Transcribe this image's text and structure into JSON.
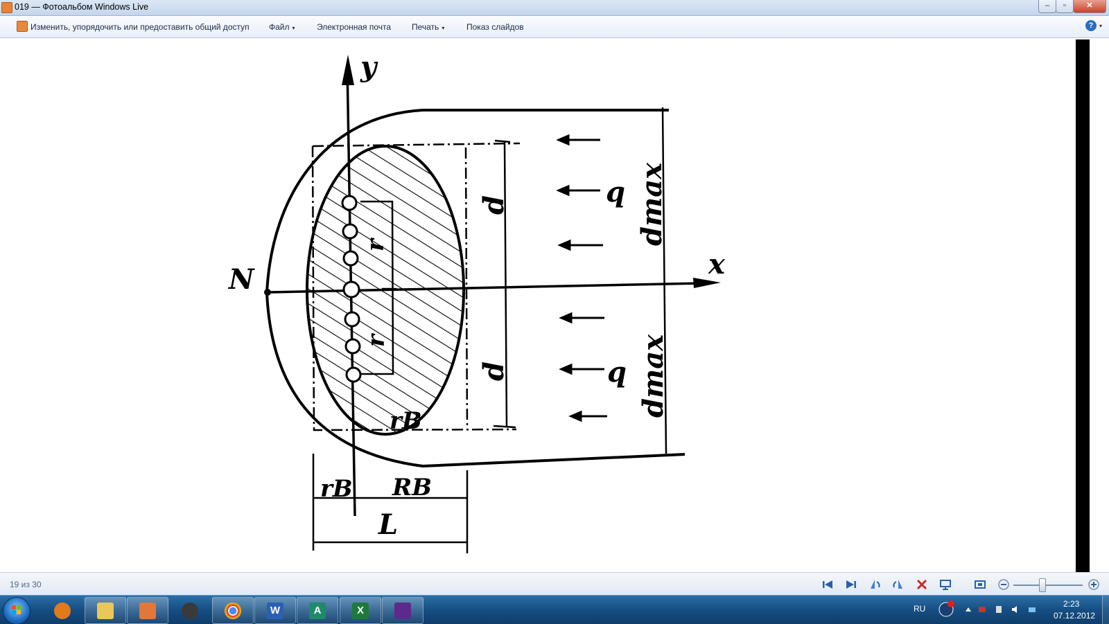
{
  "window": {
    "title": "019 — Фотоальбом Windows Live",
    "minimize_symbol": "–",
    "maximize_symbol": "▫",
    "close_symbol": "✕"
  },
  "menu": {
    "organize_label": "Изменить, упорядочить или предоставить общий доступ",
    "file_label": "Файл",
    "email_label": "Электронная почта",
    "print_label": "Печать",
    "slideshow_label": "Показ слайдов",
    "dropdown_symbol": "▾",
    "help_symbol": "?"
  },
  "image": {
    "label_y": "y",
    "label_x": "x",
    "label_N": "N",
    "label_d_top": "d",
    "label_d_bottom": "d",
    "label_dmax_top": "dmax",
    "label_dmax_bottom": "dmax",
    "label_q_top": "q",
    "label_q_bottom": "q",
    "label_r_top": "r",
    "label_r_bottom": "r",
    "label_rB": "rB",
    "label_RB": "RB",
    "label_L": "L"
  },
  "status": {
    "counter": "19 из 30",
    "zoom_level": 0.42
  },
  "taskbar": {
    "apps": [
      "media-player",
      "explorer",
      "photo-gallery",
      "hp",
      "chrome",
      "word",
      "access",
      "excel",
      "onenote"
    ],
    "word_glyph": "W",
    "access_glyph": "A",
    "excel_glyph": "X",
    "language": "RU",
    "time": "2:23",
    "date": "07.12.2012"
  },
  "colors": {
    "taskbar": "#1b5a92",
    "titlebar": "#c4d6ec",
    "close_button": "#c7432b",
    "accent": "#2d6cc0"
  }
}
